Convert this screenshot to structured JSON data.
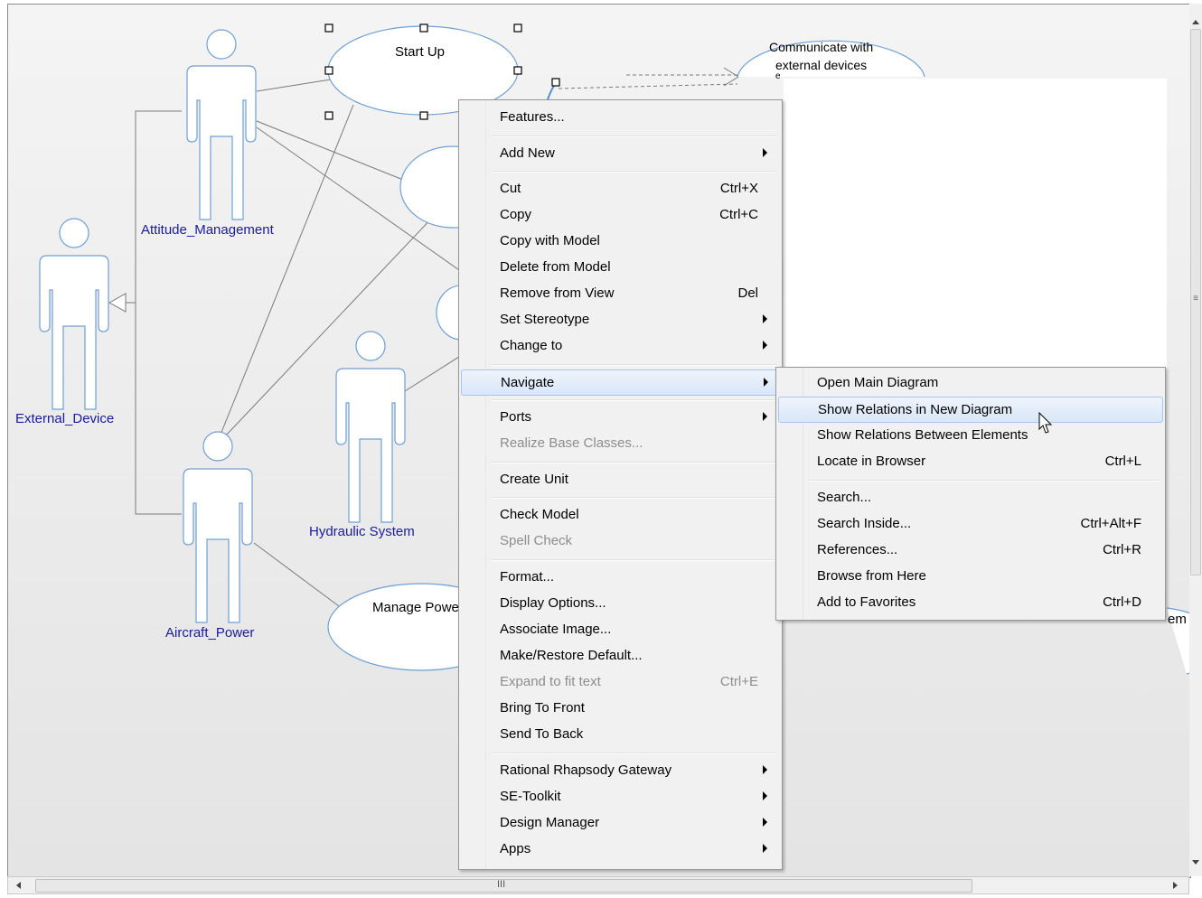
{
  "diagram": {
    "use_cases": {
      "start_up": "Start Up",
      "communicate_line1": "Communicate with",
      "communicate_line2": "external devices",
      "communicate_line3": "e",
      "manage_power": "Manage Powe",
      "partial_right": "em"
    },
    "actors": {
      "attitude_management": "Attitude_Management",
      "external_device": "External_Device",
      "hydraulic_system": "Hydraulic System",
      "aircraft_power": "Aircraft_Power"
    }
  },
  "context_menu": {
    "items": [
      {
        "label": "Features..."
      },
      {
        "label": "Add New",
        "submenu": true
      },
      {
        "label": "Cut",
        "shortcut": "Ctrl+X"
      },
      {
        "label": "Copy",
        "shortcut": "Ctrl+C"
      },
      {
        "label": "Copy with Model"
      },
      {
        "label": "Delete from Model"
      },
      {
        "label": "Remove from View",
        "shortcut": "Del"
      },
      {
        "label": "Set Stereotype",
        "submenu": true
      },
      {
        "label": "Change to",
        "submenu": true
      },
      {
        "label": "Navigate",
        "submenu": true,
        "highlighted": true
      },
      {
        "label": "Ports",
        "submenu": true
      },
      {
        "label": "Realize Base Classes...",
        "disabled": true
      },
      {
        "label": "Create Unit"
      },
      {
        "label": "Check Model"
      },
      {
        "label": "Spell Check",
        "disabled": true
      },
      {
        "label": "Format..."
      },
      {
        "label": "Display Options..."
      },
      {
        "label": "Associate Image..."
      },
      {
        "label": "Make/Restore Default..."
      },
      {
        "label": "Expand to fit text",
        "shortcut": "Ctrl+E",
        "disabled": true
      },
      {
        "label": "Bring To Front"
      },
      {
        "label": "Send To Back"
      },
      {
        "label": "Rational Rhapsody Gateway",
        "submenu": true
      },
      {
        "label": "SE-Toolkit",
        "submenu": true
      },
      {
        "label": "Design Manager",
        "submenu": true
      },
      {
        "label": "Apps",
        "submenu": true
      }
    ]
  },
  "navigate_submenu": {
    "items": [
      {
        "label": "Open Main Diagram"
      },
      {
        "label": "Show Relations in New Diagram",
        "highlighted": true
      },
      {
        "label": "Show Relations Between Elements"
      },
      {
        "label": "Locate in Browser",
        "shortcut": "Ctrl+L"
      },
      {
        "label": "Search..."
      },
      {
        "label": "Search Inside...",
        "shortcut": "Ctrl+Alt+F"
      },
      {
        "label": "References...",
        "shortcut": "Ctrl+R"
      },
      {
        "label": "Browse from Here"
      },
      {
        "label": "Add to Favorites",
        "shortcut": "Ctrl+D"
      }
    ]
  },
  "scrollbar": {
    "h_grip": "III",
    "v_grip": "≡"
  }
}
